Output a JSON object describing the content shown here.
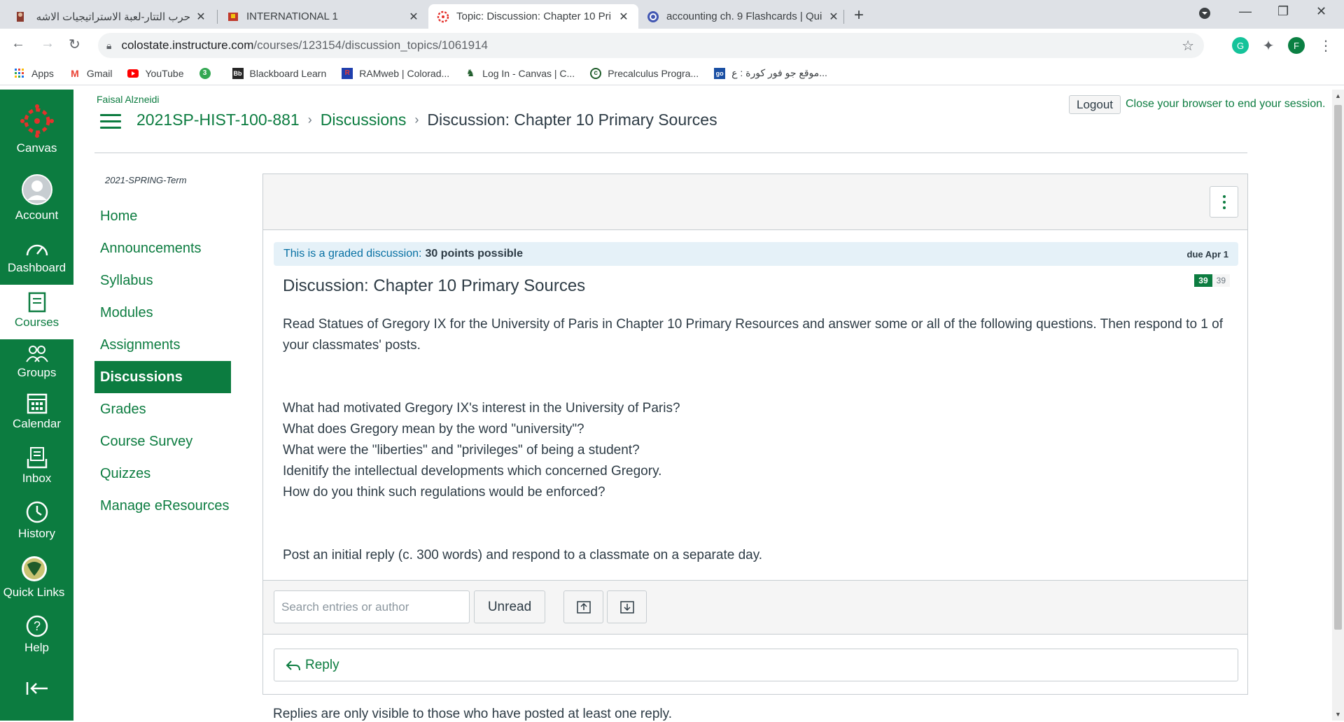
{
  "browser": {
    "tabs": [
      {
        "title": "حرب التتار-لعبة الاستراتيجيات الاشه",
        "active": false
      },
      {
        "title": "INTERNATIONAL 1",
        "active": false
      },
      {
        "title": "Topic: Discussion: Chapter 10 Pri",
        "active": true
      },
      {
        "title": "accounting ch. 9 Flashcards | Qui",
        "active": false
      }
    ],
    "url_host": "colostate.instructure.com",
    "url_path": "/courses/123154/discussion_topics/1061914",
    "profile_initial": "F",
    "bookmarks": [
      "Apps",
      "Gmail",
      "YouTube",
      "Blackboard Learn",
      "RAMweb | Colorad...",
      "Log In - Canvas | C...",
      "Precalculus Progra...",
      "موقع جو فور كورة : ع..."
    ]
  },
  "global_nav": {
    "canvas": "Canvas",
    "account": "Account",
    "dashboard": "Dashboard",
    "courses": "Courses",
    "groups": "Groups",
    "calendar": "Calendar",
    "inbox": "Inbox",
    "history": "History",
    "quick_links": "Quick Links",
    "help": "Help"
  },
  "header": {
    "user_name": "Faisal Alzneidi",
    "breadcrumb": [
      "2021SP-HIST-100-881",
      "Discussions",
      "Discussion: Chapter 10 Primary Sources"
    ],
    "logout": "Logout",
    "close_msg": "Close your browser to end your session."
  },
  "course_nav": {
    "term": "2021-SPRING-Term",
    "items": [
      "Home",
      "Announcements",
      "Syllabus",
      "Modules",
      "Assignments",
      "Discussions",
      "Grades",
      "Course Survey",
      "Quizzes",
      "Manage eResources"
    ],
    "active": "Discussions"
  },
  "discussion": {
    "graded_label": "This is a graded discussion:",
    "points": "30 points possible",
    "due": "due Apr 1",
    "title": "Discussion: Chapter 10 Primary Sources",
    "unread_count": "39",
    "total_count": "39",
    "intro": "Read Statues of Gregory IX for the University of Paris in Chapter 10 Primary Resources and answer some or all of the following questions.  Then respond to 1 of your classmates' posts.",
    "questions": [
      "What had motivated Gregory IX's interest in the University of Paris?",
      "What does Gregory mean by the word \"university\"?",
      "What were the \"liberties\" and \"privileges\" of being a student?",
      "Idenitify the intellectual developments which concerned Gregory.",
      "How do you think such regulations would be enforced?"
    ],
    "instructions": "Post an initial reply (c. 300 words) and respond to a classmate on a separate day.",
    "search_placeholder": "Search entries or author",
    "unread_button": "Unread",
    "reply": "Reply",
    "replies_note": "Replies are only visible to those who have posted at least one reply."
  },
  "colors": {
    "brand": "#0c7c40",
    "link_blue": "#0770a3"
  }
}
